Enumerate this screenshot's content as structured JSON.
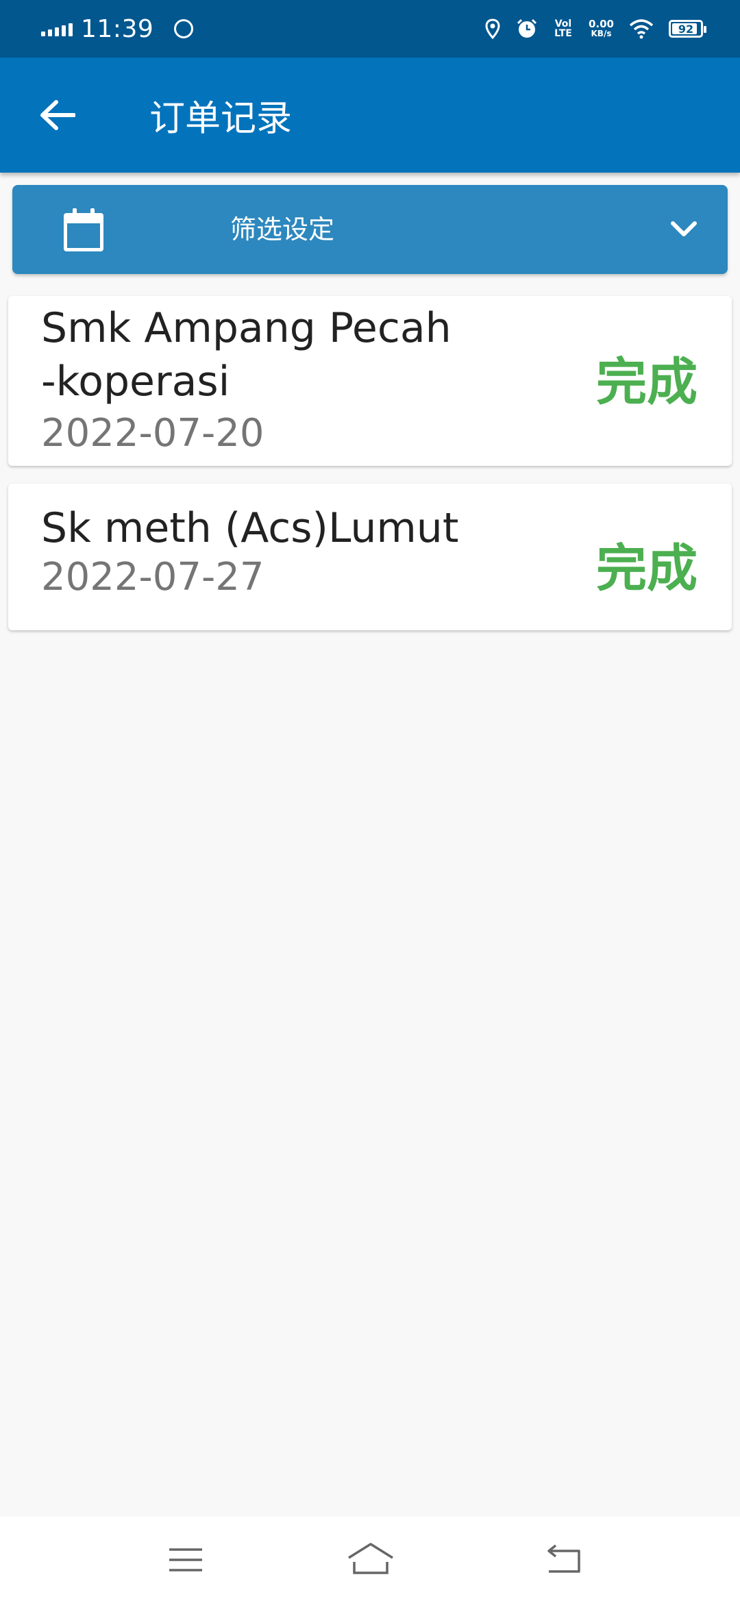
{
  "status_bar": {
    "time": "11:39",
    "battery": "92",
    "volte_label": "Vol LTE",
    "speed_value": "0.00",
    "speed_unit": "KB/s"
  },
  "app_bar": {
    "title": "订单记录"
  },
  "filter": {
    "label": "筛选设定"
  },
  "orders": [
    {
      "name_line1": "Smk Ampang Pecah",
      "name_line2": "-koperasi",
      "date": "2022-07-20",
      "status": "完成"
    },
    {
      "name_line1": "Sk meth (Acs)Lumut",
      "date": "2022-07-27",
      "status": "完成"
    }
  ],
  "colors": {
    "status_bar": "#02578f",
    "app_bar": "#0373bc",
    "filter_bar": "#2c88be",
    "status_done": "#4caf50"
  }
}
